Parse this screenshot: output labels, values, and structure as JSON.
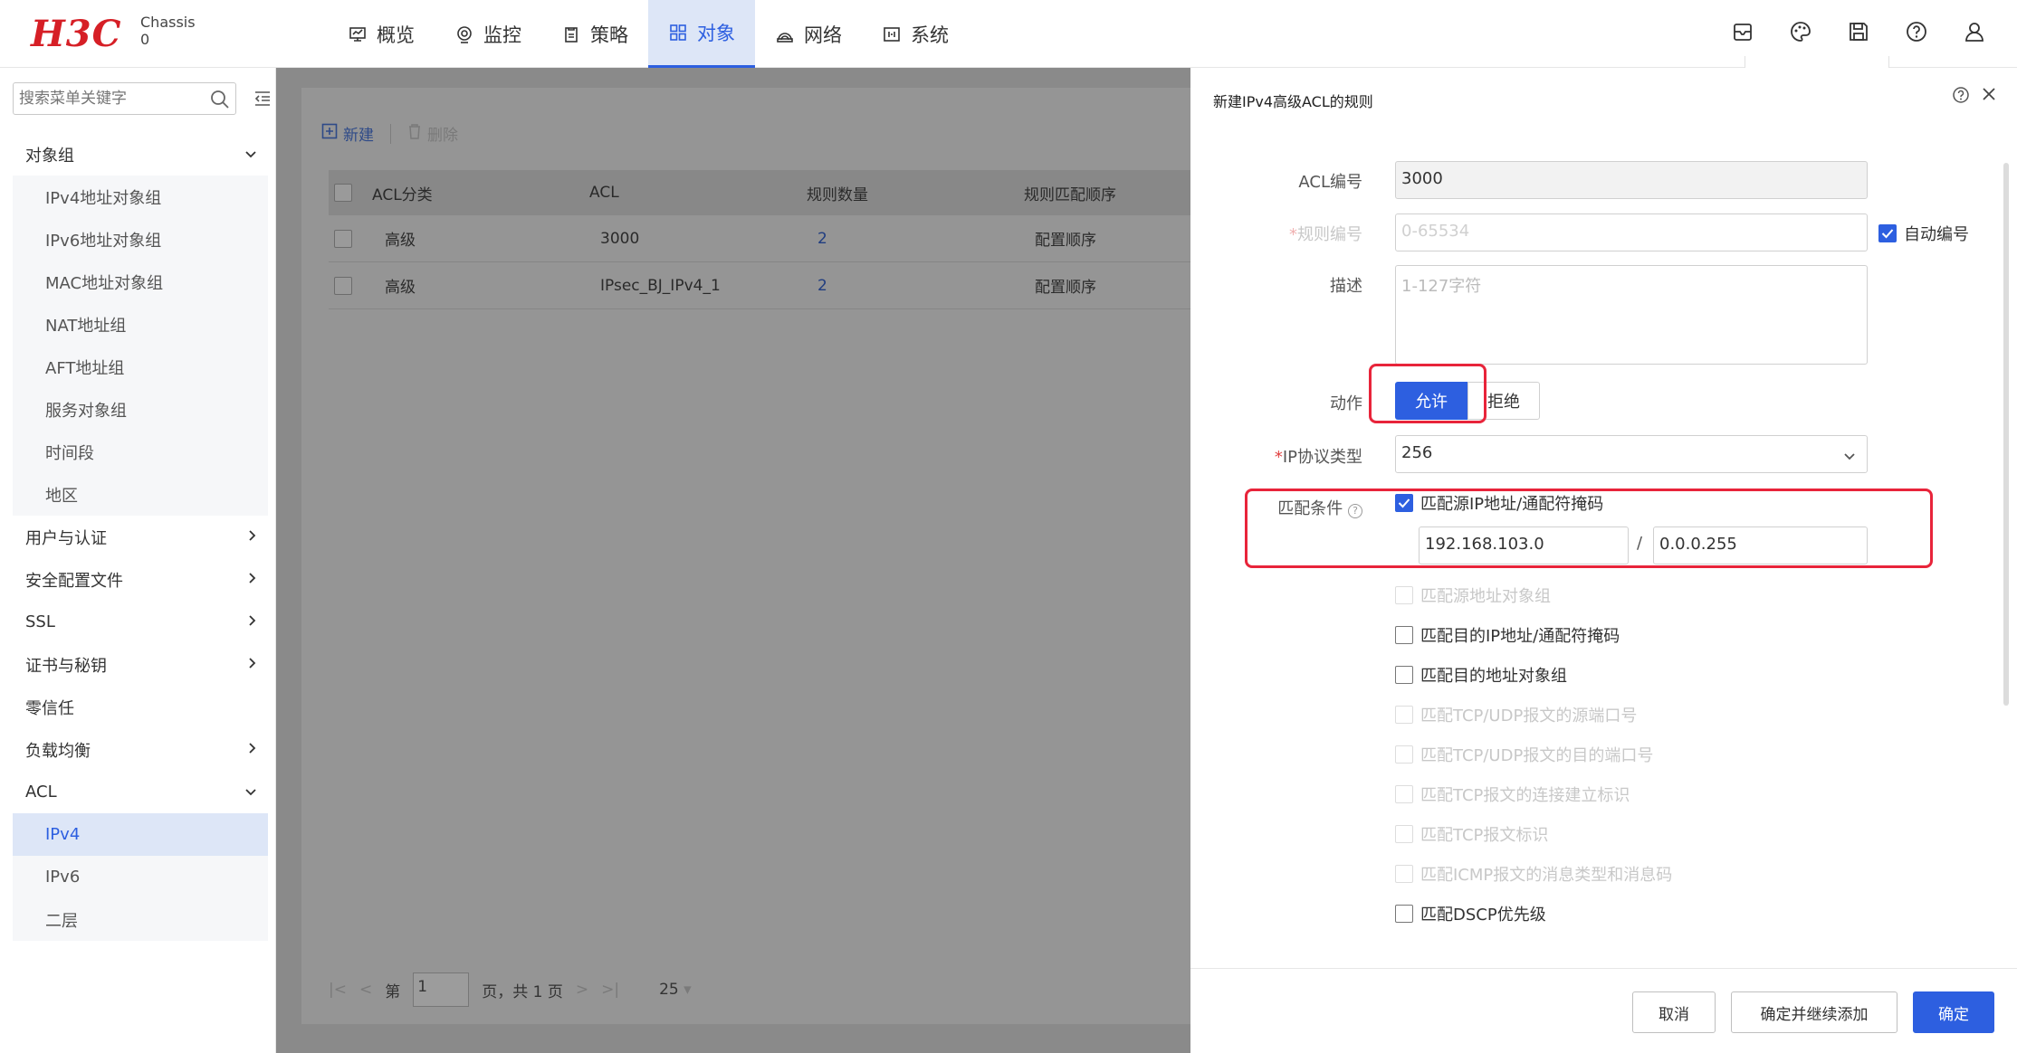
{
  "brand": {
    "logo": "H3C",
    "chassis_label": "Chassis",
    "chassis_value": "0"
  },
  "nav": {
    "items": [
      {
        "label": "概览",
        "icon": "monitor-icon"
      },
      {
        "label": "监控",
        "icon": "location-icon"
      },
      {
        "label": "策略",
        "icon": "clipboard-icon"
      },
      {
        "label": "对象",
        "icon": "grid-icon"
      },
      {
        "label": "网络",
        "icon": "network-icon"
      },
      {
        "label": "系统",
        "icon": "system-icon"
      }
    ],
    "active": "对象"
  },
  "top_icons": [
    "mailbox-icon",
    "palette-icon",
    "save-icon",
    "help-icon",
    "user-icon"
  ],
  "sidebar": {
    "search_placeholder": "搜索菜单关键字",
    "groups": [
      {
        "label": "对象组",
        "expanded": true,
        "items": [
          "IPv4地址对象组",
          "IPv6地址对象组",
          "MAC地址对象组",
          "NAT地址组",
          "AFT地址组",
          "服务对象组",
          "时间段",
          "地区"
        ]
      },
      {
        "label": "用户与认证",
        "expanded": false
      },
      {
        "label": "安全配置文件",
        "expanded": false
      },
      {
        "label": "SSL",
        "expanded": false
      },
      {
        "label": "证书与秘钥",
        "expanded": false
      },
      {
        "label": "零信任",
        "expanded": false,
        "leaf": true
      },
      {
        "label": "负载均衡",
        "expanded": false
      },
      {
        "label": "ACL",
        "expanded": true,
        "items": [
          "IPv4",
          "IPv6",
          "二层"
        ]
      }
    ],
    "active_item": "IPv4"
  },
  "list": {
    "toolbar": {
      "new_label": "新建",
      "delete_label": "删除"
    },
    "columns": [
      "ACL分类",
      "ACL",
      "规则数量",
      "规则匹配顺序"
    ],
    "rows": [
      [
        "高级",
        "3000",
        "2",
        "配置顺序"
      ],
      [
        "高级",
        "IPsec_BJ_IPv4_1",
        "2",
        "配置顺序"
      ]
    ],
    "pager": {
      "page_prefix": "第",
      "page_value": "1",
      "page_suffix": "页，共 1 页",
      "page_size": "25"
    }
  },
  "dialog": {
    "title": "新建IPv4高级ACL的规则",
    "acl_number_label": "ACL编号",
    "acl_number_value": "3000",
    "rule_number_label": "规则编号",
    "rule_number_placeholder": "0-65534",
    "auto_number_label": "自动编号",
    "desc_label": "描述",
    "desc_placeholder": "1-127字符",
    "action_label": "动作",
    "action_allow": "允许",
    "action_deny": "拒绝",
    "protocol_label": "IP协议类型",
    "protocol_value": "256",
    "match_label": "匹配条件",
    "match_src_ip_label": "匹配源IP地址/通配符掩码",
    "src_ip_value": "192.168.103.0",
    "src_mask_value": "0.0.0.255",
    "slash": "/",
    "conditions": [
      {
        "label": "匹配源地址对象组",
        "enabled": false
      },
      {
        "label": "匹配目的IP地址/通配符掩码",
        "enabled": true
      },
      {
        "label": "匹配目的地址对象组",
        "enabled": true
      },
      {
        "label": "匹配TCP/UDP报文的源端口号",
        "enabled": false
      },
      {
        "label": "匹配TCP/UDP报文的目的端口号",
        "enabled": false
      },
      {
        "label": "匹配TCP报文的连接建立标识",
        "enabled": false
      },
      {
        "label": "匹配TCP报文标识",
        "enabled": false
      },
      {
        "label": "匹配ICMP报文的消息类型和消息码",
        "enabled": false
      },
      {
        "label": "匹配DSCP优先级",
        "enabled": true
      }
    ],
    "footer": {
      "cancel": "取消",
      "save_continue": "确定并继续添加",
      "ok": "确定"
    }
  },
  "colors": {
    "accent": "#2d5fe0",
    "brand_red": "#d61f26",
    "highlight_red": "#e8243a"
  }
}
